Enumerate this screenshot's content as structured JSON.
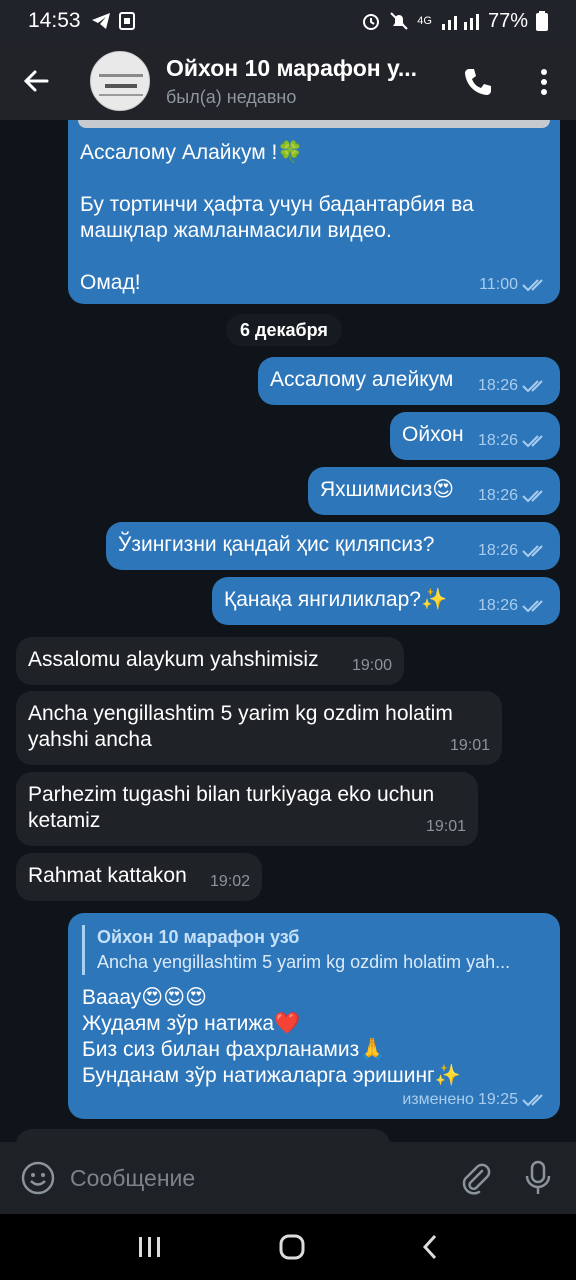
{
  "status": {
    "time": "14:53",
    "network": "4G",
    "battery": "77%",
    "icons": [
      "telegram-icon",
      "screenshot-icon",
      "alarm-icon",
      "mute-icon",
      "signal-icon",
      "battery-icon"
    ]
  },
  "header": {
    "title": "Ойхон 10 марафон у...",
    "subtitle": "был(а) недавно"
  },
  "messages": {
    "m0": {
      "lines": [
        "Ассалому Алайкум !🍀",
        "",
        "Бу тортинчи ҳафта учун бадантарбия ва",
        "машқлар жамланмасили видео.",
        "",
        "Омад!"
      ],
      "time": "11:00"
    },
    "date": "6 декабря",
    "m1": {
      "text": "Ассалому алейкум",
      "time": "18:26"
    },
    "m2": {
      "text": "Ойхон",
      "time": "18:26"
    },
    "m3": {
      "text": "Яхшимисиз😍",
      "time": "18:26"
    },
    "m4": {
      "text": "Ўзингизни қандай ҳис қиляпсиз?",
      "time": "18:26"
    },
    "m5": {
      "text": "Қанақа янгиликлар?✨",
      "time": "18:26"
    },
    "m6": {
      "text": "Assalomu alaykum yahshimisiz",
      "time": "19:00"
    },
    "m7": {
      "lines": [
        "Ancha yengillashtim 5 yarim kg ozdim holatim",
        "yahshi ancha"
      ],
      "time": "19:01"
    },
    "m8": {
      "lines": [
        "Parhezim tugashi bilan turkiyaga eko uchun",
        "ketamiz"
      ],
      "time": "19:01"
    },
    "m9": {
      "text": "Rahmat kattakon",
      "time": "19:02"
    },
    "m10": {
      "reply_name": "Ойхон 10 марафон узб",
      "reply_text": "Ancha yengillashtim 5 yarim kg ozdim holatim yah...",
      "lines": [
        "Вааау😍😍😍",
        "Жудаям зўр натижа❤️",
        "Биз сиз билан фахрланамиз🙏",
        "Бунданам зўр натижаларга эришинг✨"
      ],
      "edited": "изменено",
      "time": "19:25"
    }
  },
  "composer": {
    "placeholder": "Сообщение"
  },
  "colors": {
    "outgoing_bubble": "#2e76ba",
    "incoming_bubble": "#1f2327",
    "chat_background": "#0e1419",
    "header": "#212329"
  }
}
